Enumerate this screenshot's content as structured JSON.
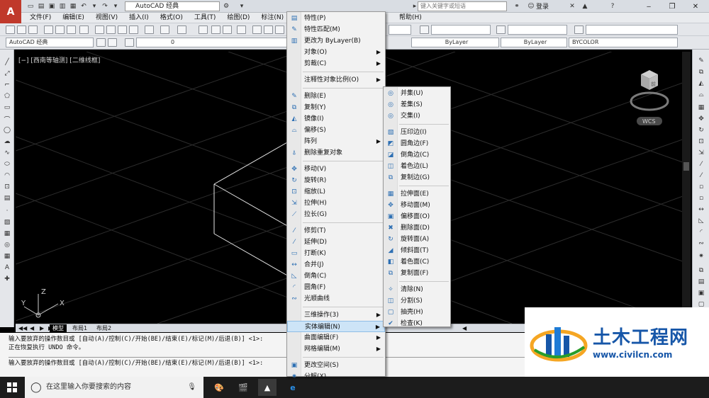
{
  "titlebar": {
    "workspace": "AutoCAD 经典",
    "search_placeholder": "键入关键字或短语",
    "login": "登录",
    "controls": [
      "‒",
      "❐",
      "✕"
    ]
  },
  "menubar": {
    "items": [
      "文件(F)",
      "编辑(E)",
      "视图(V)",
      "插入(I)",
      "格式(O)",
      "工具(T)",
      "绘图(D)",
      "标注(N)",
      "帮助(H)"
    ]
  },
  "toolbar2": {
    "workspace_combo": "AutoCAD 经典",
    "layer_value": "0",
    "linetype1": "ByLayer",
    "linetype2": "ByLayer",
    "color": "BYCOLOR"
  },
  "viewport": {
    "label": "[−] [西南等轴测] [二维线框]",
    "wcs": "WCS",
    "viewcube_face": "前"
  },
  "tabs": [
    "模型",
    "布局1",
    "布局2"
  ],
  "command": {
    "lines": [
      "输入要放弃的操作数目或 [自动(A)/控制(C)/开始(BE)/结束(E)/标记(M)/后退(B)] <1>:",
      "正在恢复执行 UNDO 命令。",
      "",
      "输入要放弃的操作数目或 [自动(A)/控制(C)/开始(BE)/结束(E)/标记(M)/后退(B)] <1>:"
    ]
  },
  "context_menu": {
    "items": [
      {
        "label": "特性(P)",
        "icon": "properties-icon",
        "sub": false
      },
      {
        "label": "特性匹配(M)",
        "icon": "match-properties-icon",
        "sub": false
      },
      {
        "label": "更改为 ByLayer(B)",
        "icon": "bylayer-icon",
        "sub": false
      },
      {
        "label": "对象(O)",
        "icon": "",
        "sub": true
      },
      {
        "label": "剪裁(C)",
        "icon": "",
        "sub": true
      },
      {
        "sep": true
      },
      {
        "label": "注释性对象比例(O)",
        "icon": "",
        "sub": true
      },
      {
        "sep": true
      },
      {
        "label": "删除(E)",
        "icon": "erase-icon",
        "sub": false
      },
      {
        "label": "复制(Y)",
        "icon": "copy-icon",
        "sub": false
      },
      {
        "label": "镜像(I)",
        "icon": "mirror-icon",
        "sub": false
      },
      {
        "label": "偏移(S)",
        "icon": "offset-icon",
        "sub": false
      },
      {
        "label": "阵列",
        "icon": "",
        "sub": true
      },
      {
        "label": "删除重复对象",
        "icon": "overkill-icon",
        "sub": false
      },
      {
        "sep": true
      },
      {
        "label": "移动(V)",
        "icon": "move-icon",
        "sub": false
      },
      {
        "label": "旋转(R)",
        "icon": "rotate-icon",
        "sub": false
      },
      {
        "label": "缩放(L)",
        "icon": "scale-icon",
        "sub": false
      },
      {
        "label": "拉伸(H)",
        "icon": "stretch-icon",
        "sub": false
      },
      {
        "label": "拉长(G)",
        "icon": "lengthen-icon",
        "sub": false
      },
      {
        "sep": true
      },
      {
        "label": "修剪(T)",
        "icon": "trim-icon",
        "sub": false
      },
      {
        "label": "延伸(D)",
        "icon": "extend-icon",
        "sub": false
      },
      {
        "label": "打断(K)",
        "icon": "break-icon",
        "sub": false
      },
      {
        "label": "合并(J)",
        "icon": "join-icon",
        "sub": false
      },
      {
        "label": "倒角(C)",
        "icon": "chamfer-icon",
        "sub": false
      },
      {
        "label": "圆角(F)",
        "icon": "fillet-icon",
        "sub": false
      },
      {
        "label": "光顺曲线",
        "icon": "blend-curves-icon",
        "sub": false
      },
      {
        "sep": true
      },
      {
        "label": "三维操作(3)",
        "icon": "",
        "sub": true
      },
      {
        "label": "实体编辑(N)",
        "icon": "",
        "sub": true,
        "highlight": true
      },
      {
        "label": "曲面编辑(F)",
        "icon": "",
        "sub": true
      },
      {
        "label": "网格编辑(M)",
        "icon": "",
        "sub": true
      },
      {
        "sep": true
      },
      {
        "label": "更改空间(S)",
        "icon": "change-space-icon",
        "sub": false
      },
      {
        "label": "分解(X)",
        "icon": "explode-icon",
        "sub": false
      }
    ]
  },
  "submenu": {
    "items": [
      {
        "label": "并集(U)",
        "icon": "union-icon"
      },
      {
        "label": "差集(S)",
        "icon": "subtract-icon"
      },
      {
        "label": "交集(I)",
        "icon": "intersect-icon"
      },
      {
        "sep": true
      },
      {
        "label": "压印边(I)",
        "icon": "imprint-icon"
      },
      {
        "label": "圆角边(F)",
        "icon": "fillet-edge-icon"
      },
      {
        "label": "倒角边(C)",
        "icon": "chamfer-edge-icon"
      },
      {
        "label": "着色边(L)",
        "icon": "color-edge-icon"
      },
      {
        "label": "复制边(G)",
        "icon": "copy-edge-icon"
      },
      {
        "sep": true
      },
      {
        "label": "拉伸面(E)",
        "icon": "extrude-face-icon"
      },
      {
        "label": "移动面(M)",
        "icon": "move-face-icon"
      },
      {
        "label": "偏移面(O)",
        "icon": "offset-face-icon"
      },
      {
        "label": "删除面(D)",
        "icon": "delete-face-icon"
      },
      {
        "label": "旋转面(A)",
        "icon": "rotate-face-icon"
      },
      {
        "label": "倾斜面(T)",
        "icon": "taper-face-icon"
      },
      {
        "label": "着色面(C)",
        "icon": "color-face-icon"
      },
      {
        "label": "复制面(F)",
        "icon": "copy-face-icon"
      },
      {
        "sep": true
      },
      {
        "label": "清除(N)",
        "icon": "clean-icon"
      },
      {
        "label": "分割(S)",
        "icon": "separate-icon"
      },
      {
        "label": "抽壳(H)",
        "icon": "shell-icon"
      },
      {
        "label": "检查(K)",
        "icon": "check-icon"
      }
    ]
  },
  "taskbar": {
    "search_placeholder": "在这里输入你要搜索的内容"
  },
  "watermark": {
    "title": "土木工程网",
    "url": "www.civilcn.com"
  }
}
